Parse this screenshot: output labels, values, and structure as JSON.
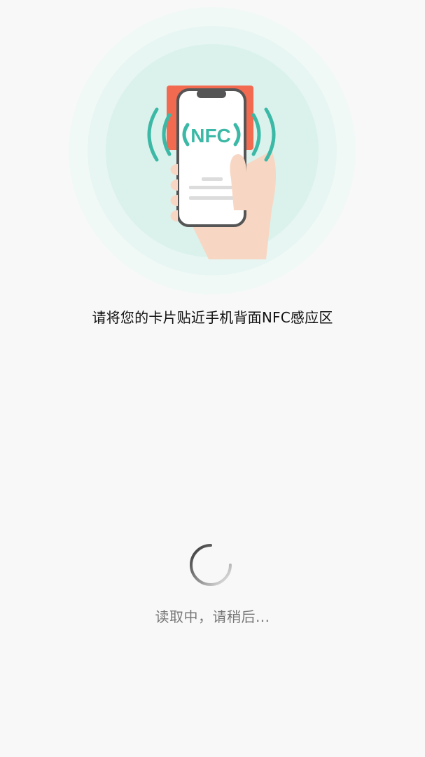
{
  "illustration": {
    "nfc_label": "NFC",
    "accent_color": "#3cb9a6",
    "card_color": "#f26a50",
    "halo_color": "#dff3ef"
  },
  "instruction_text": "请将您的卡片贴近手机背面NFC感应区",
  "status_text": "读取中，请稍后...",
  "icons": [
    "nfc-tap-illustration",
    "loading-spinner-icon"
  ]
}
